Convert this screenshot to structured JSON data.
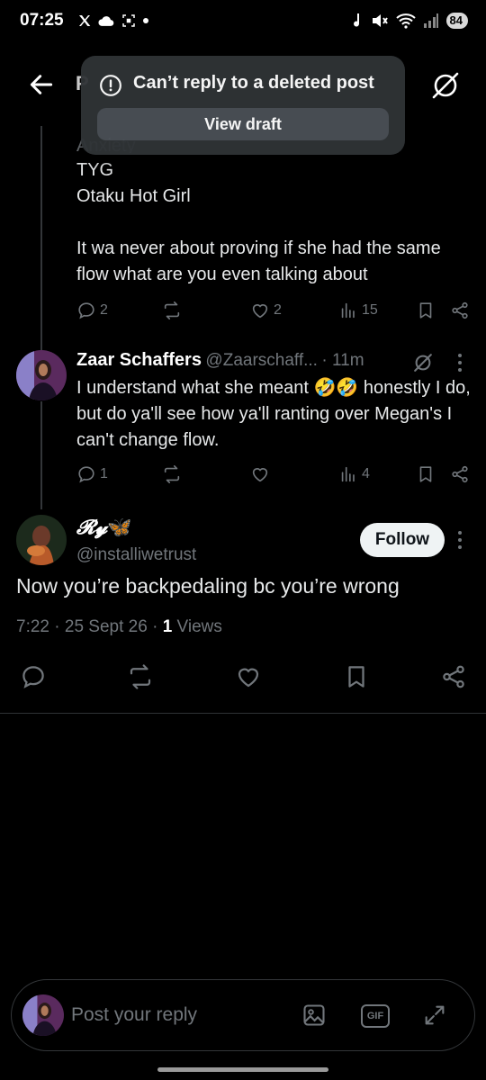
{
  "status_bar": {
    "time": "07:25",
    "battery": "84"
  },
  "header": {
    "title_partial": "P"
  },
  "toast": {
    "message": "Can’t reply to a deleted post",
    "button": "View draft"
  },
  "parent_post": {
    "lines": [
      "Anxiety",
      "TYG",
      "Otaku Hot Girl"
    ],
    "text": "It wa never about proving if she had the same flow what are you even talking about",
    "replies": "2",
    "reposts": "",
    "likes": "2",
    "views": "15"
  },
  "reply_post": {
    "name": "Zaar Schaffers",
    "handle": "@Zaarschaff...",
    "time": "· 11m",
    "text_before": "I understand what she meant ",
    "emoji": "🤣🤣",
    "text_after": " honestly I do, but do ya'll see how ya'll ranting over Megan's I can't change flow.",
    "replies": "1",
    "reposts": "",
    "likes": "",
    "views": "4"
  },
  "main_post": {
    "name": "𝓡𝔂",
    "butterfly": "🦋",
    "handle": "@installiwetrust",
    "follow": "Follow",
    "text": "Now you’re backpedaling bc you’re wrong",
    "time": "7:22",
    "date": "25 Sept 26",
    "views_count": "1",
    "views_label": "Views"
  },
  "reply_bar": {
    "placeholder": "Post your reply",
    "gif": "GIF"
  },
  "colors": {
    "bg": "#000000",
    "text": "#e7e9ea",
    "muted": "#71767b",
    "toast": "#2f3336"
  }
}
